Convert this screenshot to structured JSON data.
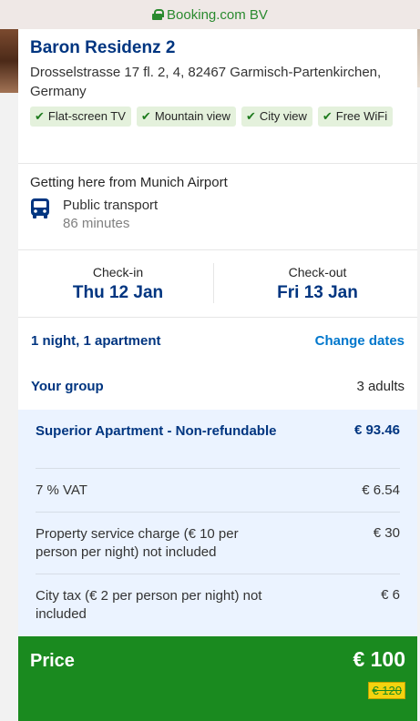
{
  "urlbar": {
    "text": "Booking.com BV"
  },
  "hotel": {
    "name": "Baron Residenz 2",
    "address": "Drosselstrasse 17 fl. 2, 4, 82467 Garmisch-Partenkirchen, Germany",
    "amenities": [
      "Flat-screen TV",
      "Mountain view",
      "City view",
      "Free WiFi"
    ]
  },
  "airport": {
    "title": "Getting here from Munich Airport",
    "mode": "Public transport",
    "duration": "86 minutes"
  },
  "dates": {
    "checkin_label": "Check-in",
    "checkin_value": "Thu 12 Jan",
    "checkout_label": "Check-out",
    "checkout_value": "Fri 13 Jan"
  },
  "stay": {
    "summary": "1 night, 1 apartment",
    "change_link": "Change dates"
  },
  "group": {
    "label": "Your group",
    "value": "3 adults"
  },
  "breakdown": {
    "room_label": "Superior Apartment - Non-refundable",
    "room_value": "€ 93.46",
    "vat_label": "7 % VAT",
    "vat_value": "€ 6.54",
    "service_label": "Property service charge (€ 10 per person per night) not included",
    "service_value": "€ 30",
    "tax_label": "City tax (€ 2 per person per night) not included",
    "tax_value": "€ 6"
  },
  "total": {
    "label": "Price",
    "value": "€ 100",
    "old_value": "€ 120"
  },
  "colors": {
    "brand": "#003580",
    "link": "#0077cc",
    "total_bg": "#1a8a1f",
    "amenity_bg": "#e4f1dc"
  },
  "icons": {
    "url_lock": "lock-icon",
    "amenity_check": "checkmark-icon",
    "transport": "bus-icon"
  }
}
